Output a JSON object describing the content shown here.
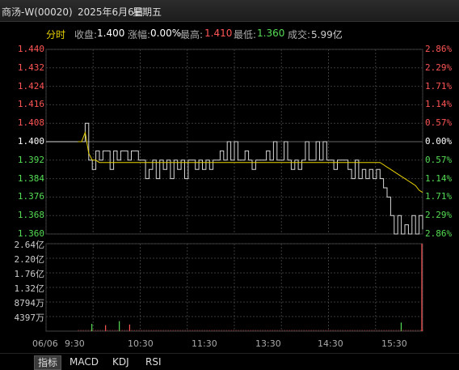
{
  "header": {
    "title": "商汤-W(00020)",
    "date": "2025年6月6日",
    "weekday": "星期五"
  },
  "info": {
    "tab_label": "分时",
    "close_label": "收盘:",
    "close_value": "1.400",
    "change_label": "涨幅:",
    "change_value": "0.00%",
    "high_label": "最高:",
    "high_value": "1.410",
    "low_label": "最低:",
    "low_value": "1.360",
    "volume_label": "成交:",
    "volume_value": "5.99亿"
  },
  "colors": {
    "up": "#ff5555",
    "down": "#55dd55",
    "neutral": "#ffffff",
    "avg_line": "#e6d200",
    "price_line": "#d8d8d8",
    "grid": "#3a3a3a"
  },
  "chart_data": {
    "type": "line",
    "price_axis_left": [
      "1.440",
      "1.432",
      "1.424",
      "1.416",
      "1.408",
      "1.400",
      "1.392",
      "1.384",
      "1.376",
      "1.368",
      "1.360"
    ],
    "price_axis_right": [
      "2.86%",
      "2.29%",
      "1.71%",
      "1.14%",
      "0.57%",
      "0.00%",
      "0.57%",
      "1.14%",
      "1.71%",
      "2.29%",
      "2.86%"
    ],
    "ylim": [
      1.36,
      1.44
    ],
    "base_price": 1.4,
    "volume_axis": [
      "2.64亿",
      "2.20亿",
      "1.76亿",
      "1.32亿",
      "8794万",
      "4397万"
    ],
    "volume_max": 264,
    "time_labels": [
      "06/06",
      "9:30",
      "10:30",
      "11:30",
      "13:30",
      "14:30",
      "15:30"
    ],
    "series": [
      {
        "key": "price",
        "values": [
          1.4,
          1.4,
          1.408,
          1.392,
          1.388,
          1.396,
          1.392,
          1.396,
          1.396,
          1.388,
          1.396,
          1.392,
          1.396,
          1.396,
          1.392,
          1.396,
          1.396,
          1.392,
          1.392,
          1.384,
          1.388,
          1.392,
          1.384,
          1.392,
          1.388,
          1.392,
          1.384,
          1.392,
          1.388,
          1.392,
          1.384,
          1.392,
          1.392,
          1.388,
          1.392,
          1.388,
          1.392,
          1.388,
          1.392,
          1.392,
          1.396,
          1.392,
          1.4,
          1.392,
          1.4,
          1.392,
          1.392,
          1.396,
          1.392,
          1.388,
          1.392,
          1.392,
          1.392,
          1.396,
          1.392,
          1.4,
          1.392,
          1.392,
          1.4,
          1.392,
          1.388,
          1.392,
          1.388,
          1.392,
          1.4,
          1.392,
          1.392,
          1.4,
          1.392,
          1.4,
          1.392,
          1.392,
          1.388,
          1.392,
          1.392,
          1.392,
          1.388,
          1.384,
          1.392,
          1.384,
          1.388,
          1.384,
          1.388,
          1.384,
          1.388,
          1.384,
          1.38,
          1.376,
          1.368,
          1.36,
          1.368,
          1.36,
          1.364,
          1.36,
          1.368,
          1.36,
          1.368,
          1.362
        ]
      },
      {
        "key": "avg",
        "values": [
          1.4,
          1.4,
          1.404,
          1.395,
          1.392,
          1.392,
          1.391,
          1.391,
          1.391,
          1.391,
          1.391,
          1.391,
          1.391,
          1.391,
          1.391,
          1.391,
          1.391,
          1.391,
          1.391,
          1.391,
          1.391,
          1.391,
          1.391,
          1.391,
          1.391,
          1.391,
          1.391,
          1.391,
          1.391,
          1.391,
          1.391,
          1.391,
          1.391,
          1.391,
          1.391,
          1.391,
          1.391,
          1.391,
          1.391,
          1.391,
          1.391,
          1.391,
          1.391,
          1.391,
          1.391,
          1.391,
          1.391,
          1.391,
          1.391,
          1.391,
          1.391,
          1.391,
          1.391,
          1.391,
          1.391,
          1.391,
          1.391,
          1.391,
          1.391,
          1.391,
          1.391,
          1.391,
          1.391,
          1.391,
          1.391,
          1.391,
          1.391,
          1.391,
          1.391,
          1.391,
          1.391,
          1.391,
          1.391,
          1.391,
          1.391,
          1.391,
          1.391,
          1.391,
          1.391,
          1.391,
          1.391,
          1.391,
          1.391,
          1.391,
          1.391,
          1.391,
          1.39,
          1.389,
          1.388,
          1.387,
          1.386,
          1.385,
          1.384,
          1.383,
          1.382,
          1.381,
          1.379,
          1.378
        ]
      }
    ],
    "volume_bars": [
      {
        "pos": 0.04,
        "value": 22,
        "dir": "down"
      },
      {
        "pos": 0.08,
        "value": 18,
        "dir": "up"
      },
      {
        "pos": 0.12,
        "value": 30,
        "dir": "down"
      },
      {
        "pos": 0.15,
        "value": 20,
        "dir": "up"
      },
      {
        "pos": 0.94,
        "value": 26,
        "dir": "down"
      },
      {
        "pos": 1.0,
        "value": 264,
        "dir": "up"
      }
    ]
  },
  "bottom_tabs": [
    "指标",
    "MACD",
    "KDJ",
    "RSI"
  ]
}
